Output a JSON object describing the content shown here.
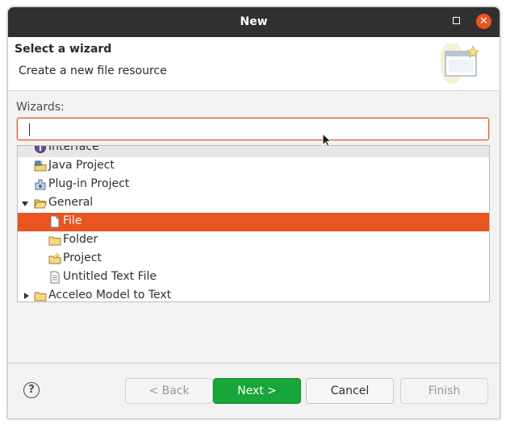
{
  "window": {
    "title": "New"
  },
  "header": {
    "title": "Select a wizard",
    "subtitle": "Create a new file resource"
  },
  "wizards_label": "Wizards:",
  "filter": {
    "value": "",
    "placeholder": ""
  },
  "tree": {
    "items": [
      {
        "label": "Interface",
        "icon": "interface-icon",
        "indent": 1,
        "expander": "none"
      },
      {
        "label": "Java Project",
        "icon": "java-project-icon",
        "indent": 1,
        "expander": "none"
      },
      {
        "label": "Plug-in Project",
        "icon": "plugin-project-icon",
        "indent": 1,
        "expander": "none"
      },
      {
        "label": "General",
        "icon": "folder-open-icon",
        "indent": 0,
        "expander": "expanded"
      },
      {
        "label": "File",
        "icon": "file-icon",
        "indent": 2,
        "expander": "none",
        "selected": true
      },
      {
        "label": "Folder",
        "icon": "folder-icon",
        "indent": 2,
        "expander": "none"
      },
      {
        "label": "Project",
        "icon": "project-icon",
        "indent": 2,
        "expander": "none"
      },
      {
        "label": "Untitled Text File",
        "icon": "text-file-icon",
        "indent": 2,
        "expander": "none"
      },
      {
        "label": "Acceleo Model to Text",
        "icon": "folder-icon",
        "indent": 0,
        "expander": "collapsed"
      }
    ]
  },
  "buttons": {
    "help": "?",
    "back": "< Back",
    "next": "Next >",
    "cancel": "Cancel",
    "finish": "Finish"
  },
  "colors": {
    "accent": "#e95420",
    "primary_button": "#18a53a",
    "titlebar": "#303030"
  }
}
